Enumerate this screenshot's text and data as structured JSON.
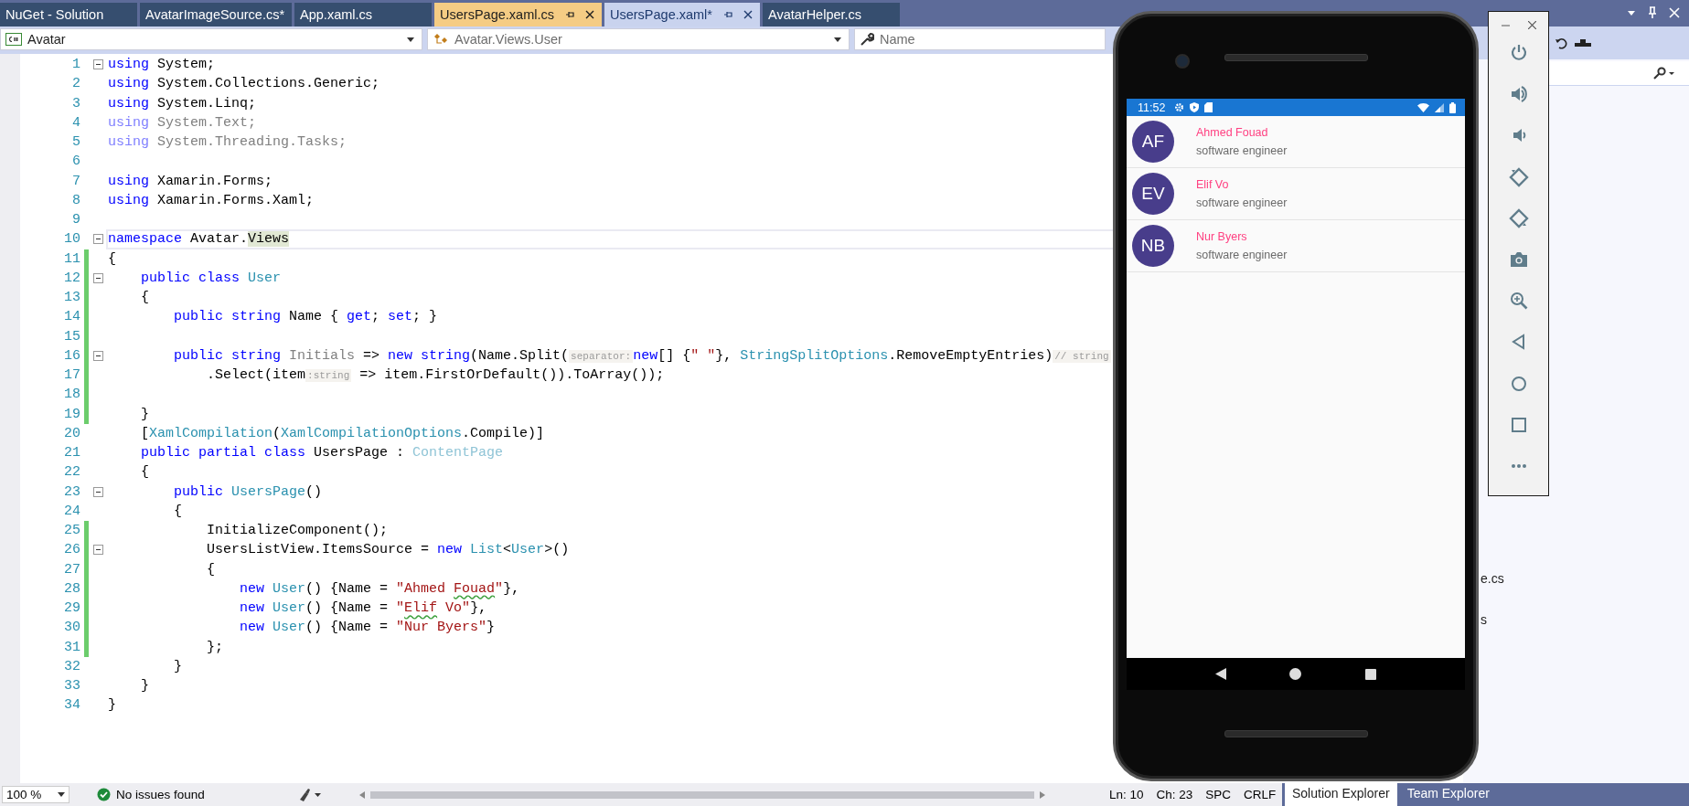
{
  "tabs": [
    {
      "label": "NuGet - Solution",
      "selected": false,
      "hover": false
    },
    {
      "label": "AvatarImageSource.cs*",
      "selected": false,
      "hover": false
    },
    {
      "label": "App.xaml.cs",
      "selected": false,
      "hover": false
    },
    {
      "label": "UsersPage.xaml.cs",
      "selected": true,
      "hover": false
    },
    {
      "label": "UsersPage.xaml*",
      "selected": false,
      "hover": true
    },
    {
      "label": "AvatarHelper.cs",
      "selected": false,
      "hover": false
    }
  ],
  "navigation_bar": {
    "project": "Avatar",
    "type": "Avatar.Views.User",
    "member": "Name"
  },
  "editor": {
    "lines": [
      {
        "number": "1",
        "fold": true,
        "changed": false,
        "current": false,
        "tokens": [
          {
            "kind": "kw",
            "text": "using"
          },
          {
            "kind": "plain",
            "text": " System;"
          }
        ]
      },
      {
        "number": "2",
        "fold": false,
        "changed": false,
        "current": false,
        "tokens": [
          {
            "kind": "kw",
            "text": "using"
          },
          {
            "kind": "plain",
            "text": " System.Collections.Generic;"
          }
        ]
      },
      {
        "number": "3",
        "fold": false,
        "changed": false,
        "current": false,
        "tokens": [
          {
            "kind": "kw",
            "text": "using"
          },
          {
            "kind": "plain",
            "text": " System.Linq;"
          }
        ]
      },
      {
        "number": "4",
        "fold": false,
        "changed": false,
        "current": false,
        "tokens": [
          {
            "kind": "dimkw",
            "text": "using"
          },
          {
            "kind": "dim",
            "text": " System.Text;"
          }
        ]
      },
      {
        "number": "5",
        "fold": false,
        "changed": false,
        "current": false,
        "tokens": [
          {
            "kind": "dimkw",
            "text": "using"
          },
          {
            "kind": "dim",
            "text": " System.Threading.Tasks;"
          }
        ]
      },
      {
        "number": "6",
        "fold": false,
        "changed": false,
        "current": false
      },
      {
        "number": "7",
        "fold": false,
        "changed": false,
        "current": false,
        "tokens": [
          {
            "kind": "kw",
            "text": "using"
          },
          {
            "kind": "plain",
            "text": " Xamarin.Forms;"
          }
        ]
      },
      {
        "number": "8",
        "fold": false,
        "changed": false,
        "current": false,
        "tokens": [
          {
            "kind": "kw",
            "text": "using"
          },
          {
            "kind": "plain",
            "text": " Xamarin.Forms.Xaml;"
          }
        ]
      },
      {
        "number": "9",
        "fold": false,
        "changed": false,
        "current": false
      },
      {
        "number": "10",
        "fold": true,
        "changed": false,
        "current": true,
        "tokens": [
          {
            "kind": "kw",
            "text": "namespace"
          },
          {
            "kind": "plain",
            "text": " Avatar."
          },
          {
            "kind": "ref",
            "text": "Views"
          }
        ]
      },
      {
        "number": "11",
        "fold": false,
        "changed": true,
        "current": false,
        "tokens": [
          {
            "kind": "plain",
            "text": "{"
          }
        ]
      },
      {
        "number": "12",
        "fold": true,
        "changed": true,
        "current": false,
        "tokens": [
          {
            "kind": "kw",
            "text": "    public class"
          },
          {
            "kind": "type",
            "text": " User"
          }
        ]
      },
      {
        "number": "13",
        "fold": false,
        "changed": true,
        "current": false,
        "tokens": [
          {
            "kind": "plain",
            "text": "    {"
          }
        ]
      },
      {
        "number": "14",
        "fold": false,
        "changed": true,
        "current": false,
        "tokens": [
          {
            "kind": "kw",
            "text": "        public string"
          },
          {
            "kind": "plain",
            "text": " Name { "
          },
          {
            "kind": "kw",
            "text": "get"
          },
          {
            "kind": "plain",
            "text": "; "
          },
          {
            "kind": "kw",
            "text": "set"
          },
          {
            "kind": "plain",
            "text": "; }"
          }
        ]
      },
      {
        "number": "15",
        "fold": false,
        "changed": true,
        "current": false
      },
      {
        "number": "16",
        "fold": true,
        "changed": true,
        "current": false,
        "tokens": [
          {
            "kind": "kw",
            "text": "        public string"
          },
          {
            "kind": "dim",
            "text": " Initials"
          },
          {
            "kind": "plain",
            "text": " => "
          },
          {
            "kind": "kw",
            "text": "new string"
          },
          {
            "kind": "plain",
            "text": "(Name.Split("
          },
          {
            "kind": "hint",
            "text": "separator:"
          },
          {
            "kind": "kw",
            "text": "new"
          },
          {
            "kind": "plain",
            "text": "[] {"
          },
          {
            "kind": "str",
            "text": "\" \""
          },
          {
            "kind": "plain",
            "text": "}, "
          },
          {
            "kind": "type",
            "text": "StringSplitOptions"
          },
          {
            "kind": "plain",
            "text": ".RemoveEmptyEntries)"
          },
          {
            "kind": "hint",
            "text": "// string"
          }
        ]
      },
      {
        "number": "17",
        "fold": false,
        "changed": true,
        "current": false,
        "tokens": [
          {
            "kind": "plain",
            "text": "            .Select(item"
          },
          {
            "kind": "hint",
            "text": ":string"
          },
          {
            "kind": "plain",
            "text": " => item.FirstOrDefault()).ToArray());"
          }
        ]
      },
      {
        "number": "18",
        "fold": false,
        "changed": true,
        "current": false
      },
      {
        "number": "19",
        "fold": false,
        "changed": true,
        "current": false,
        "tokens": [
          {
            "kind": "plain",
            "text": "    }"
          }
        ]
      },
      {
        "number": "20",
        "fold": false,
        "changed": false,
        "current": false,
        "tokens": [
          {
            "kind": "plain",
            "text": "    ["
          },
          {
            "kind": "type",
            "text": "XamlCompilation"
          },
          {
            "kind": "plain",
            "text": "("
          },
          {
            "kind": "type",
            "text": "XamlCompilationOptions"
          },
          {
            "kind": "plain",
            "text": ".Compile)]"
          }
        ]
      },
      {
        "number": "21",
        "fold": false,
        "changed": false,
        "current": false,
        "tokens": [
          {
            "kind": "kw",
            "text": "    public partial class"
          },
          {
            "kind": "plain",
            "text": " UsersPage : "
          },
          {
            "kind": "dimtype",
            "text": "ContentPage"
          }
        ]
      },
      {
        "number": "22",
        "fold": false,
        "changed": false,
        "current": false,
        "tokens": [
          {
            "kind": "plain",
            "text": "    {"
          }
        ]
      },
      {
        "number": "23",
        "fold": true,
        "changed": false,
        "current": false,
        "tokens": [
          {
            "kind": "kw",
            "text": "        public"
          },
          {
            "kind": "type",
            "text": " UsersPage"
          },
          {
            "kind": "plain",
            "text": "()"
          }
        ]
      },
      {
        "number": "24",
        "fold": false,
        "changed": false,
        "current": false,
        "tokens": [
          {
            "kind": "plain",
            "text": "        {"
          }
        ]
      },
      {
        "number": "25",
        "fold": false,
        "changed": true,
        "current": false,
        "tokens": [
          {
            "kind": "plain",
            "text": "            InitializeComponent();"
          }
        ]
      },
      {
        "number": "26",
        "fold": true,
        "changed": true,
        "current": false,
        "tokens": [
          {
            "kind": "plain",
            "text": "            UsersListView.ItemsSource = "
          },
          {
            "kind": "kw",
            "text": "new"
          },
          {
            "kind": "type",
            "text": " List"
          },
          {
            "kind": "plain",
            "text": "<"
          },
          {
            "kind": "type",
            "text": "User"
          },
          {
            "kind": "plain",
            "text": ">()"
          }
        ]
      },
      {
        "number": "27",
        "fold": false,
        "changed": true,
        "current": false,
        "tokens": [
          {
            "kind": "plain",
            "text": "            {"
          }
        ]
      },
      {
        "number": "28",
        "fold": false,
        "changed": true,
        "current": false,
        "tokens": [
          {
            "kind": "kw",
            "text": "                new"
          },
          {
            "kind": "type",
            "text": " User"
          },
          {
            "kind": "plain",
            "text": "() {Name = "
          },
          {
            "kind": "str",
            "text": "\"Ahmed "
          },
          {
            "kind": "spell",
            "text": "Fouad"
          },
          {
            "kind": "str",
            "text": "\""
          },
          {
            "kind": "plain",
            "text": "},"
          }
        ]
      },
      {
        "number": "29",
        "fold": false,
        "changed": true,
        "current": false,
        "tokens": [
          {
            "kind": "kw",
            "text": "                new"
          },
          {
            "kind": "type",
            "text": " User"
          },
          {
            "kind": "plain",
            "text": "() {Name = "
          },
          {
            "kind": "str",
            "text": "\""
          },
          {
            "kind": "spell",
            "text": "Elif"
          },
          {
            "kind": "str",
            "text": " Vo\""
          },
          {
            "kind": "plain",
            "text": "},"
          }
        ]
      },
      {
        "number": "30",
        "fold": false,
        "changed": true,
        "current": false,
        "tokens": [
          {
            "kind": "kw",
            "text": "                new"
          },
          {
            "kind": "type",
            "text": " User"
          },
          {
            "kind": "plain",
            "text": "() {Name = "
          },
          {
            "kind": "str",
            "text": "\"Nur Byers\""
          },
          {
            "kind": "plain",
            "text": "}"
          }
        ]
      },
      {
        "number": "31",
        "fold": false,
        "changed": true,
        "current": false,
        "tokens": [
          {
            "kind": "plain",
            "text": "            };"
          }
        ]
      },
      {
        "number": "32",
        "fold": false,
        "changed": false,
        "current": false,
        "tokens": [
          {
            "kind": "plain",
            "text": "        }"
          }
        ]
      },
      {
        "number": "33",
        "fold": false,
        "changed": false,
        "current": false,
        "tokens": [
          {
            "kind": "plain",
            "text": "    }"
          }
        ]
      },
      {
        "number": "34",
        "fold": false,
        "changed": false,
        "current": false,
        "tokens": [
          {
            "kind": "plain",
            "text": "}"
          }
        ]
      }
    ]
  },
  "solution_explorer": {
    "items": [
      {
        "text": "e.cs"
      },
      {
        "text": "s"
      }
    ]
  },
  "phone": {
    "time": "11:52",
    "users": [
      {
        "initials": "AF",
        "name": "Ahmed Fouad",
        "subtitle": "software engineer"
      },
      {
        "initials": "EV",
        "name": "Elif Vo",
        "subtitle": "software engineer"
      },
      {
        "initials": "NB",
        "name": "Nur Byers",
        "subtitle": "software engineer"
      }
    ]
  },
  "emulator_toolbar": {
    "buttons": [
      {
        "kind": "power"
      },
      {
        "kind": "volume_up"
      },
      {
        "kind": "volume_down"
      },
      {
        "kind": "rotate_left"
      },
      {
        "kind": "rotate_right"
      },
      {
        "kind": "camera"
      },
      {
        "kind": "zoom"
      },
      {
        "kind": "back"
      },
      {
        "kind": "home"
      },
      {
        "kind": "overview"
      },
      {
        "kind": "more"
      }
    ]
  },
  "status_bar": {
    "zoom": "100 %",
    "issues": "No issues found",
    "line": "Ln: 10",
    "column": "Ch: 23",
    "indent": "SPC",
    "line_ending": "CRLF",
    "tool_tabs": [
      {
        "label": "Solution Explorer",
        "selected": true
      },
      {
        "label": "Team Explorer",
        "selected": false
      }
    ]
  }
}
